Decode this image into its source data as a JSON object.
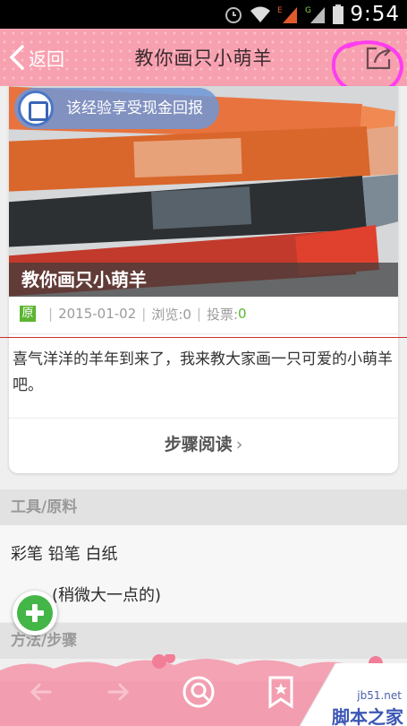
{
  "status_bar": {
    "time": "9:54",
    "icons": [
      "alarm-icon",
      "wifi-icon",
      "signal-e-icon",
      "signal-g-icon",
      "battery-icon"
    ]
  },
  "header": {
    "back_label": "返回",
    "title": "教你画只小萌羊",
    "share_icon": "share-icon"
  },
  "article": {
    "reward_text": "该经验享受现金回报",
    "photo_caption": "教你画只小萌羊",
    "badge": "原",
    "date": "2015-01-02",
    "views": "浏览:0",
    "votes_label": "投票:",
    "votes_value": "0",
    "intro": "喜气洋洋的羊年到来了，我来教大家画一只可爱的小萌羊吧。",
    "read_steps": "步骤阅读"
  },
  "tools": {
    "heading": "工具/原料",
    "items": [
      "彩笔 铅笔 白纸",
      "橡皮(稍微大一点的)"
    ],
    "item_2_visible": "(稍微大一点的)"
  },
  "method": {
    "heading": "方法/步骤"
  },
  "bottom_bar": {
    "buttons": [
      "back-arrow-icon",
      "forward-arrow-icon",
      "search-icon",
      "bookmark-icon"
    ]
  },
  "watermark": {
    "site": "jb51.net",
    "name": "脚本之家"
  },
  "colors": {
    "header_pink": "#f7a1b0",
    "accent_green": "#5cb531",
    "reward_blue": "#6e96d7"
  }
}
